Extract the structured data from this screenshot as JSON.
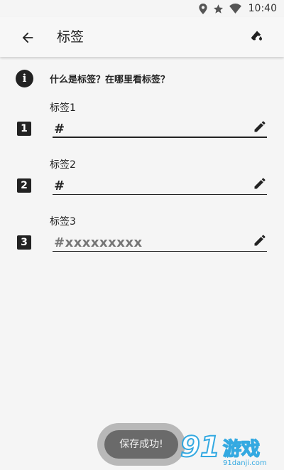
{
  "status_bar": {
    "time": "10:40"
  },
  "app_bar": {
    "title": "标签"
  },
  "info": {
    "text": "什么是标签？在哪里看标签？"
  },
  "tags": [
    {
      "number": "1",
      "label": "标签1",
      "value": "#",
      "placeholder": ""
    },
    {
      "number": "2",
      "label": "标签2",
      "value": "#",
      "placeholder": ""
    },
    {
      "number": "3",
      "label": "标签3",
      "value": "",
      "placeholder": "#xxxxxxxxx"
    }
  ],
  "toast": {
    "text": "保存成功!"
  },
  "watermark": {
    "logo_text": "91游戏",
    "url_text": "91danji.com"
  },
  "colors": {
    "background": "#f5f5f5",
    "text": "#222222",
    "toast_bg": "#6a6a6a",
    "watermark": "#2aa5e0"
  }
}
